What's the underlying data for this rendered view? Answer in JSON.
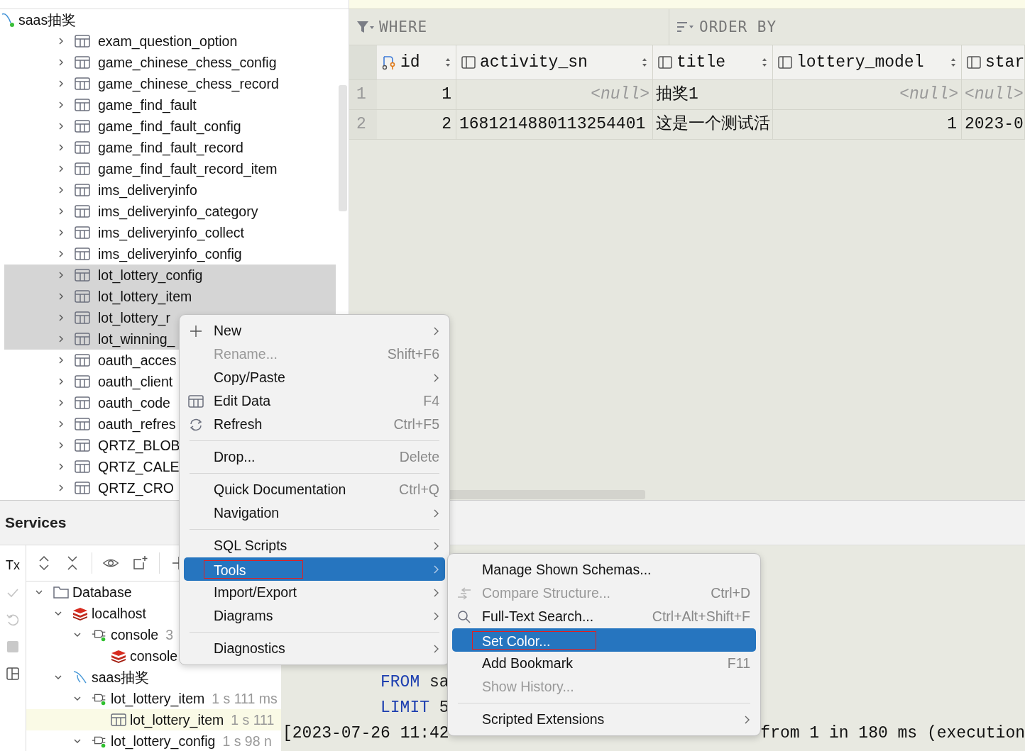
{
  "db_tree": {
    "root": {
      "label": "saas抽奖"
    },
    "items": [
      {
        "label": "exam_question_option",
        "expanded": false,
        "selected": false
      },
      {
        "label": "game_chinese_chess_config",
        "expanded": false,
        "selected": false
      },
      {
        "label": "game_chinese_chess_record",
        "expanded": false,
        "selected": false
      },
      {
        "label": "game_find_fault",
        "expanded": false,
        "selected": false
      },
      {
        "label": "game_find_fault_config",
        "expanded": false,
        "selected": false
      },
      {
        "label": "game_find_fault_record",
        "expanded": false,
        "selected": false
      },
      {
        "label": "game_find_fault_record_item",
        "expanded": false,
        "selected": false
      },
      {
        "label": "ims_deliveryinfo",
        "expanded": false,
        "selected": false
      },
      {
        "label": "ims_deliveryinfo_category",
        "expanded": false,
        "selected": false
      },
      {
        "label": "ims_deliveryinfo_collect",
        "expanded": false,
        "selected": false
      },
      {
        "label": "ims_deliveryinfo_config",
        "expanded": false,
        "selected": false
      },
      {
        "label": "lot_lottery_config",
        "expanded": false,
        "selected": true
      },
      {
        "label": "lot_lottery_item",
        "expanded": false,
        "selected": true
      },
      {
        "label": "lot_lottery_r",
        "expanded": false,
        "selected": true
      },
      {
        "label": "lot_winning_",
        "expanded": false,
        "selected": true
      },
      {
        "label": "oauth_acces",
        "expanded": false,
        "selected": false
      },
      {
        "label": "oauth_client",
        "expanded": false,
        "selected": false
      },
      {
        "label": "oauth_code",
        "expanded": false,
        "selected": false
      },
      {
        "label": "oauth_refres",
        "expanded": false,
        "selected": false
      },
      {
        "label": "QRTZ_BLOB",
        "expanded": false,
        "selected": false
      },
      {
        "label": "QRTZ_CALE",
        "expanded": false,
        "selected": false
      },
      {
        "label": "QRTZ_CRO",
        "expanded": false,
        "selected": false
      }
    ]
  },
  "filter_bar": {
    "where": "WHERE",
    "order_by": "ORDER BY"
  },
  "grid": {
    "columns": [
      {
        "name": "id",
        "kind": "key"
      },
      {
        "name": "activity_sn",
        "kind": "column"
      },
      {
        "name": "title",
        "kind": "column"
      },
      {
        "name": "lottery_model",
        "kind": "column"
      },
      {
        "name": "star",
        "kind": "column"
      }
    ],
    "rows": [
      {
        "number": "1",
        "cells": [
          {
            "text": "1",
            "kind": "number"
          },
          {
            "text": "<null>",
            "kind": "null"
          },
          {
            "text": "抽奖1",
            "kind": "text"
          },
          {
            "text": "<null>",
            "kind": "null"
          },
          {
            "text": "<null>",
            "kind": "null-left"
          }
        ]
      },
      {
        "number": "2",
        "cells": [
          {
            "text": "2",
            "kind": "number"
          },
          {
            "text": "1681214880113254401",
            "kind": "text"
          },
          {
            "text": "这是一个测试活",
            "kind": "text"
          },
          {
            "text": "1",
            "kind": "number"
          },
          {
            "text": "2023-0",
            "kind": "text"
          }
        ]
      }
    ]
  },
  "services": {
    "title": "Services",
    "transaction_label": "Tx",
    "tree": [
      {
        "label": "Database",
        "kind": "folder",
        "expanded": true,
        "selected": false,
        "children": [
          {
            "label": "localhost",
            "kind": "redis",
            "expanded": true,
            "selected": false,
            "children": [
              {
                "label": "console",
                "detail": "3",
                "kind": "session",
                "expanded": true,
                "selected": false,
                "children": [
                  {
                    "label": "console",
                    "kind": "redis",
                    "selected": false
                  }
                ]
              }
            ]
          },
          {
            "label": "saas抽奖",
            "kind": "mysql",
            "expanded": true,
            "selected": false,
            "children": [
              {
                "label": "lot_lottery_item",
                "detail": "1 s 111 ms",
                "kind": "session",
                "expanded": true,
                "selected": false,
                "children": [
                  {
                    "label": "lot_lottery_item",
                    "detail": "1 s 111",
                    "kind": "table",
                    "selected": true
                  }
                ]
              },
              {
                "label": "lot_lottery_config",
                "detail": "1 s 98 n",
                "kind": "session",
                "expanded": true,
                "selected": false
              }
            ]
          }
        ]
      }
    ]
  },
  "console": {
    "lines": [
      {
        "keyword": "FROM",
        "rest": "sa"
      },
      {
        "keyword": "LIMIT",
        "rest": "5"
      }
    ],
    "log_start": "[2023-07-26 11:42",
    "log_end": "from 1 in 180 ms (execution"
  },
  "context_menu": {
    "items": [
      {
        "kind": "item",
        "label": "New",
        "submenu": true,
        "disabled": false,
        "selected": false,
        "outlined": false
      },
      {
        "kind": "item",
        "label": "Rename...",
        "shortcut": "Shift+F6",
        "disabled": true,
        "selected": false,
        "outlined": false
      },
      {
        "kind": "item",
        "label": "Copy/Paste",
        "submenu": true,
        "disabled": false,
        "selected": false,
        "outlined": false
      },
      {
        "kind": "item",
        "label": "Edit Data",
        "shortcut": "F4",
        "disabled": false,
        "selected": false,
        "outlined": false
      },
      {
        "kind": "item",
        "label": "Refresh",
        "shortcut": "Ctrl+F5",
        "disabled": false,
        "selected": false,
        "outlined": false
      },
      {
        "kind": "separator"
      },
      {
        "kind": "item",
        "label": "Drop...",
        "shortcut": "Delete",
        "disabled": false,
        "selected": false,
        "outlined": false
      },
      {
        "kind": "separator"
      },
      {
        "kind": "item",
        "label": "Quick Documentation",
        "shortcut": "Ctrl+Q",
        "disabled": false,
        "selected": false,
        "outlined": false
      },
      {
        "kind": "item",
        "label": "Navigation",
        "submenu": true,
        "disabled": false,
        "selected": false,
        "outlined": false
      },
      {
        "kind": "separator"
      },
      {
        "kind": "item",
        "label": "SQL Scripts",
        "submenu": true,
        "disabled": false,
        "selected": false,
        "outlined": false
      },
      {
        "kind": "item",
        "label": "Tools",
        "submenu": true,
        "disabled": false,
        "selected": true,
        "outlined": true
      },
      {
        "kind": "item",
        "label": "Import/Export",
        "submenu": true,
        "disabled": false,
        "selected": false,
        "outlined": false
      },
      {
        "kind": "item",
        "label": "Diagrams",
        "submenu": true,
        "disabled": false,
        "selected": false,
        "outlined": false
      },
      {
        "kind": "separator"
      },
      {
        "kind": "item",
        "label": "Diagnostics",
        "submenu": true,
        "disabled": false,
        "selected": false,
        "outlined": false
      }
    ]
  },
  "tools_submenu": {
    "items": [
      {
        "kind": "item",
        "label": "Manage Shown Schemas...",
        "disabled": false,
        "selected": false,
        "outlined": false
      },
      {
        "kind": "item",
        "label": "Compare Structure...",
        "shortcut": "Ctrl+D",
        "disabled": true,
        "selected": false,
        "outlined": false
      },
      {
        "kind": "item",
        "label": "Full-Text Search...",
        "shortcut": "Ctrl+Alt+Shift+F",
        "disabled": false,
        "selected": false,
        "outlined": false
      },
      {
        "kind": "item",
        "label": "Set Color...",
        "disabled": false,
        "selected": true,
        "outlined": true
      },
      {
        "kind": "item",
        "label": "Add Bookmark",
        "shortcut": "F11",
        "disabled": false,
        "selected": false,
        "outlined": false
      },
      {
        "kind": "item",
        "label": "Show History...",
        "disabled": true,
        "selected": false,
        "outlined": false
      },
      {
        "kind": "separator"
      },
      {
        "kind": "item",
        "label": "Scripted Extensions",
        "submenu": true,
        "disabled": false,
        "selected": false,
        "outlined": false
      }
    ]
  }
}
